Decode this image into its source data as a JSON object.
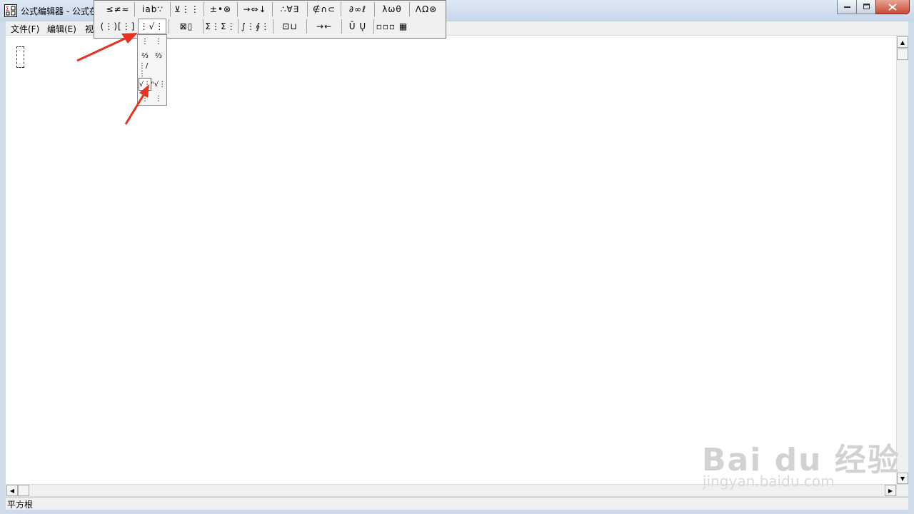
{
  "window": {
    "title": "公式编辑器 - 公式在"
  },
  "menu": [
    "文件(F)",
    "编辑(E)",
    "视"
  ],
  "palette": {
    "row1": [
      "≤≠≈",
      "ⅰab∵",
      "⊻⋮⋮",
      "±•⊗",
      "→⇔↓",
      "∴∀∃",
      "∉∩⊂",
      "∂∞ℓ",
      "λωθ",
      "ΛΩ⊛"
    ],
    "row2": [
      "(⋮)[⋮]",
      "⋮√⋮",
      "⊠▯",
      "Σ⋮Σ⋮",
      "∫⋮∮⋮",
      "⊡⊔",
      "→←",
      "Ū Ų",
      "▫▫▫ ▦"
    ]
  },
  "dropdown": {
    "cells": [
      "⋮",
      "⋮",
      "⅔",
      "⅔",
      "⋮/⋮",
      "",
      "√⋮",
      "ⁿ√⋮",
      "⋮",
      "⋮"
    ]
  },
  "statusbar": {
    "text": "平方根"
  },
  "watermark": {
    "main": "Bai du 经验",
    "sub": "jingyan.baidu.com"
  },
  "colors": {
    "arrow": "#e8321e",
    "titlebar": "#c6d6ea"
  }
}
